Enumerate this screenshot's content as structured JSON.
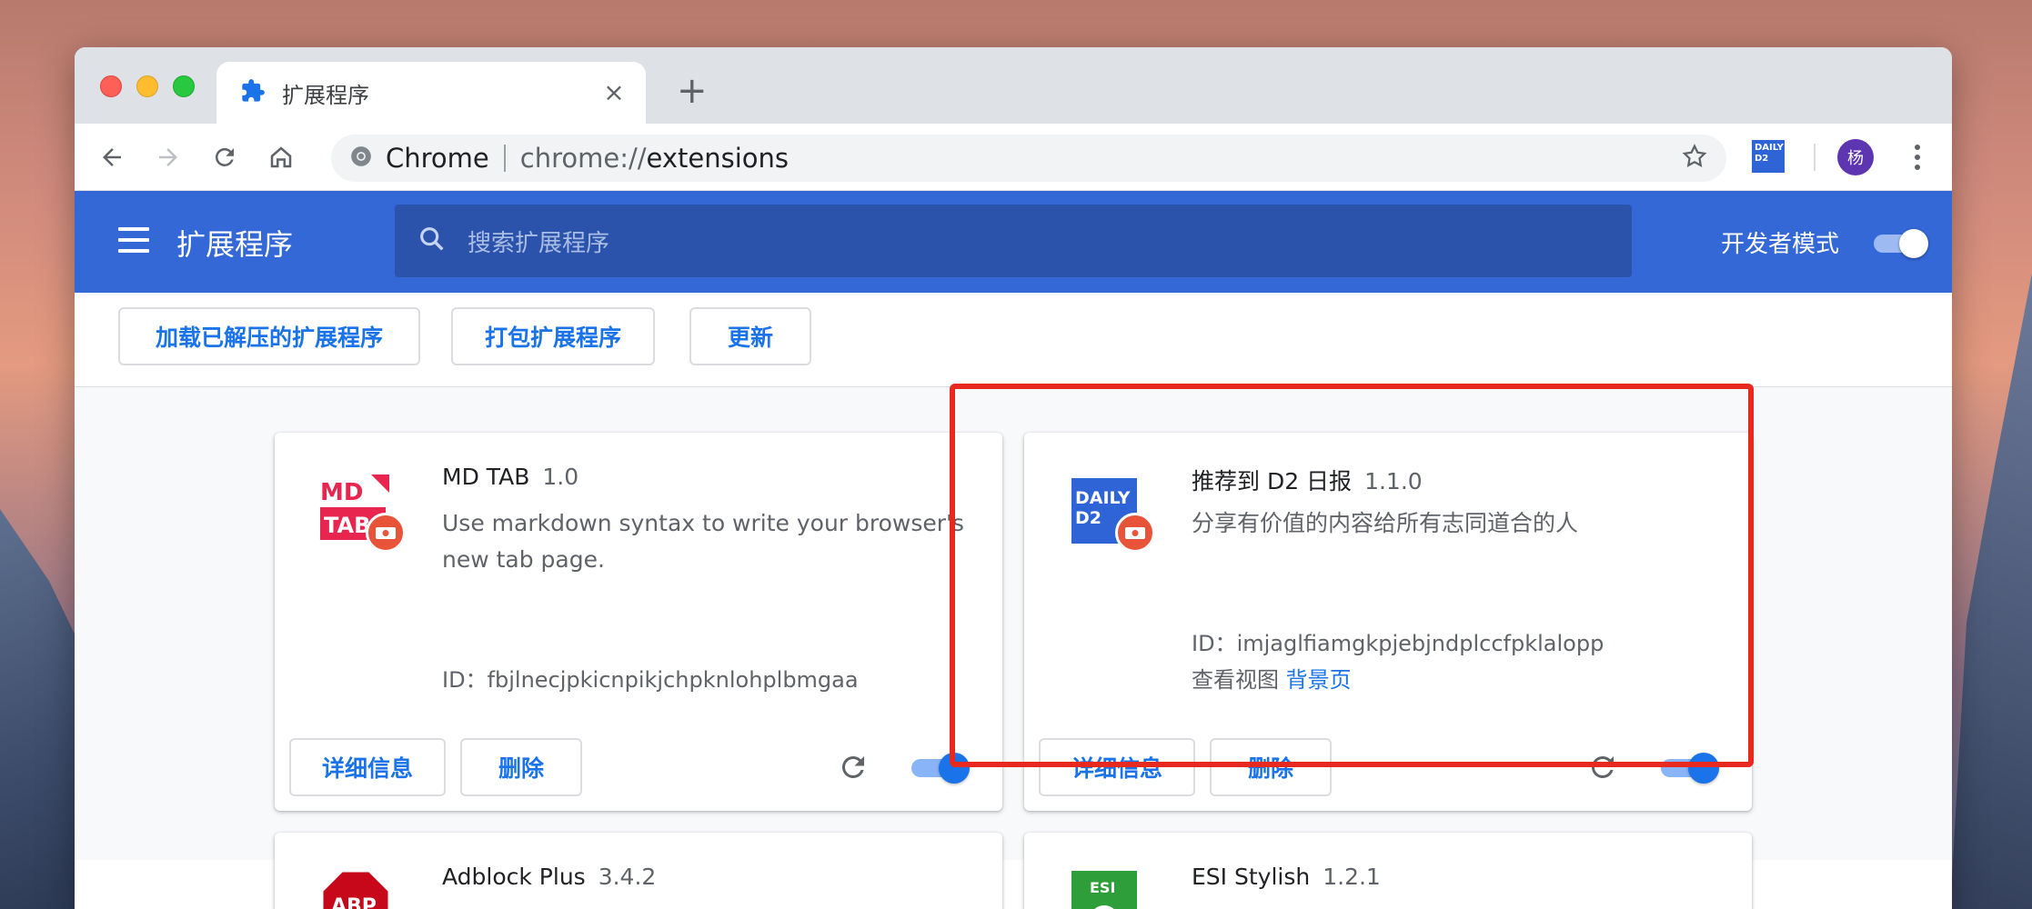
{
  "browser": {
    "tab": {
      "title": "扩展程序",
      "close": "×"
    },
    "new_tab": "+",
    "omnibox": {
      "site_label": "Chrome",
      "url_scheme": "chrome://",
      "url_path": "extensions"
    },
    "daily_icon_text": "DAILY D2",
    "avatar_initial": "杨"
  },
  "header": {
    "title": "扩展程序",
    "search_placeholder": "搜索扩展程序",
    "dev_mode_label": "开发者模式",
    "dev_mode_on": true
  },
  "actions": {
    "load_unpacked": "加载已解压的扩展程序",
    "pack": "打包扩展程序",
    "update": "更新"
  },
  "extensions": [
    {
      "name": "MD TAB",
      "version": "1.0",
      "description": "Use markdown syntax to write your browser's new tab page.",
      "id_label": "ID：",
      "id": "fbjlnecjpkicnpikjchpknlohplbmgaa",
      "details": "详细信息",
      "remove": "删除",
      "enabled": true,
      "logo_text_1": "MD",
      "logo_text_2": "TAB"
    },
    {
      "name": "推荐到 D2 日报",
      "version": "1.1.0",
      "description": "分享有价值的内容给所有志同道合的人",
      "id_label": "ID：",
      "id": "imjaglfiamgkpjebjndplccfpklalopp",
      "view_label": "查看视图",
      "view_link": "背景页",
      "details": "详细信息",
      "remove": "删除",
      "enabled": true,
      "logo_text": "DAILY D2",
      "highlighted": true
    },
    {
      "name": "Adblock Plus",
      "version": "3.4.2",
      "logo_text": "ABP"
    },
    {
      "name": "ESI Stylish",
      "version": "1.2.1",
      "logo_text": "ESI"
    }
  ],
  "colors": {
    "header_blue": "#3468d6",
    "link_blue": "#1a73e8",
    "highlight_red": "#e8291f"
  }
}
